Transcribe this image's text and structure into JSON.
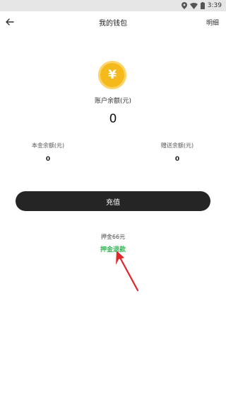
{
  "status_bar": {
    "time": "3:39"
  },
  "header": {
    "title": "我的钱包",
    "detail_label": "明细"
  },
  "balance": {
    "currency_symbol": "¥",
    "label": "账户余额(元)",
    "value": "0"
  },
  "principal": {
    "label": "本金余额(元)",
    "value": "0"
  },
  "bonus": {
    "label": "赠送余额(元)",
    "value": "0"
  },
  "recharge": {
    "label": "充值"
  },
  "deposit": {
    "amount_text": "押金66元",
    "refund_label": "押金退款"
  },
  "colors": {
    "accent_green": "#2dbb52",
    "coin": "#f6b91c",
    "button": "#252525",
    "annotation_red": "#e0262b"
  },
  "icons": [
    "location-icon",
    "wifi-icon",
    "battery-icon",
    "back-arrow-icon"
  ]
}
